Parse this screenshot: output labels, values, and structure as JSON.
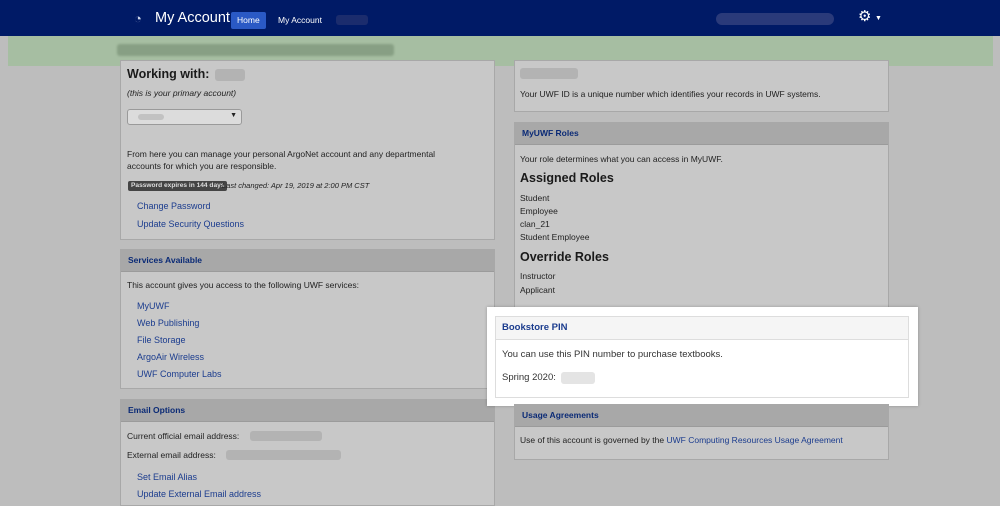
{
  "navbar": {
    "app_title": "My Account",
    "home_label": "Home",
    "myaccount_label": "My Account"
  },
  "working": {
    "title": "Working with:",
    "subtitle": "(this is your primary account)",
    "description_line1": "From here you can manage your personal ArgoNet account and any departmental",
    "description_line2": "accounts for which you are responsible.",
    "password_badge": "Password expires in 144 days",
    "last_changed": "Last changed: Apr 19, 2019 at 2:00 PM CST",
    "links": [
      "Change Password",
      "Update Security Questions"
    ]
  },
  "services": {
    "heading": "Services Available",
    "intro": "This account gives you access to the following UWF services:",
    "items": [
      "MyUWF",
      "Web Publishing",
      "File Storage",
      "ArgoAir Wireless",
      "UWF Computer Labs"
    ]
  },
  "email": {
    "heading": "Email Options",
    "current_label": "Current official email address:",
    "external_label": "External email address:",
    "links": [
      "Set Email Alias",
      "Update External Email address"
    ]
  },
  "uwfid": {
    "description": "Your UWF ID is a unique number which identifies your records in UWF systems."
  },
  "roles": {
    "heading": "MyUWF Roles",
    "intro": "Your role determines what you can access in MyUWF.",
    "assigned_heading": "Assigned Roles",
    "assigned": [
      "Student",
      "Employee",
      "clan_21",
      "Student Employee"
    ],
    "override_heading": "Override Roles",
    "override": [
      "Instructor",
      "Applicant"
    ]
  },
  "bookstore": {
    "heading": "Bookstore PIN",
    "description": "You can use this PIN number to purchase textbooks.",
    "term_label": "Spring 2020:"
  },
  "usage": {
    "heading": "Usage Agreements",
    "text": "Use of this account is governed by the",
    "link": "UWF Computing Resources Usage Agreement"
  },
  "colors": {
    "navbar": "#001a66",
    "active_nav": "#2a59c5",
    "link": "#1b3c8e",
    "alert": "#a6bea2"
  },
  "icons": {
    "brand": "person-circle-icon",
    "settings": "gear-icon"
  }
}
